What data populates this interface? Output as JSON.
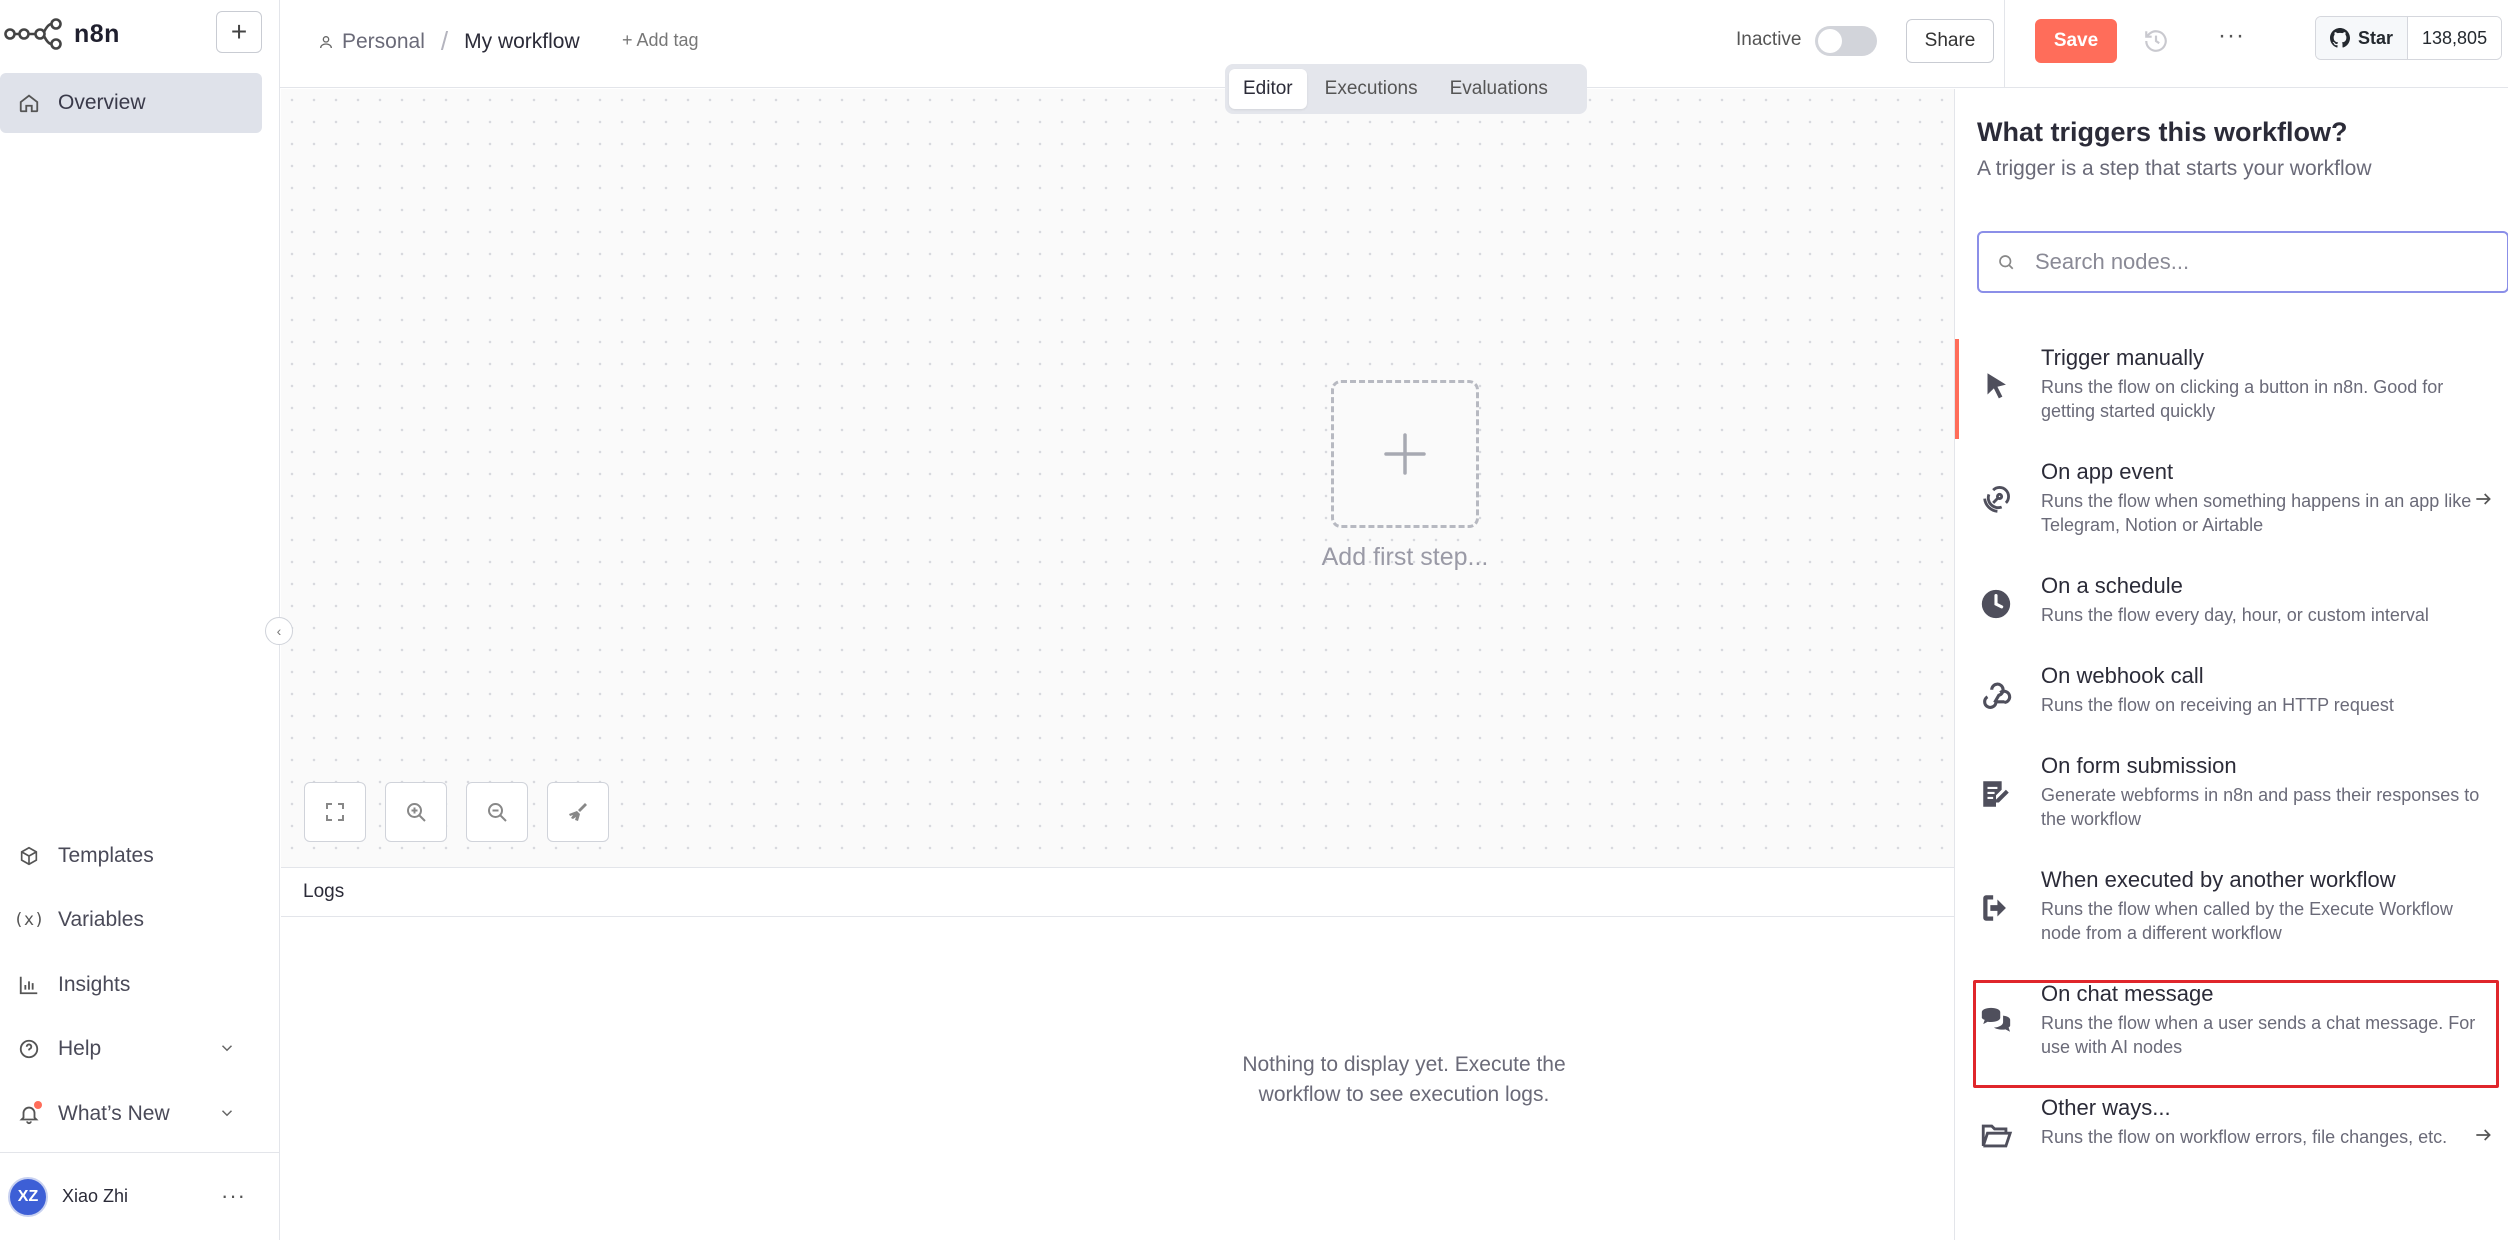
{
  "app": {
    "logo_text": "n8n"
  },
  "sidebar": {
    "overview": "Overview",
    "bottom_items": [
      {
        "label": "Templates",
        "icon": "box-icon"
      },
      {
        "label": "Variables",
        "icon": "variable-icon"
      },
      {
        "label": "Insights",
        "icon": "chart-icon"
      },
      {
        "label": "Help",
        "icon": "help-icon"
      },
      {
        "label": "What’s New",
        "icon": "bell-icon"
      }
    ],
    "user": {
      "initials": "XZ",
      "name": "Xiao Zhi"
    }
  },
  "header": {
    "project": "Personal",
    "workflow_name": "My workflow",
    "add_tag": "+ Add tag",
    "status_label": "Inactive",
    "share_label": "Share",
    "save_label": "Save",
    "github_star": "Star",
    "github_count": "138,805"
  },
  "canvas": {
    "tabs": [
      "Editor",
      "Executions",
      "Evaluations"
    ],
    "active_tab": "Editor",
    "add_first_step": "Add first step..."
  },
  "logs": {
    "title": "Logs",
    "empty_line1": "Nothing to display yet. Execute the",
    "empty_line2": "workflow to see execution logs."
  },
  "panel": {
    "title": "What triggers this workflow?",
    "subtitle": "A trigger is a step that starts your workflow",
    "search_placeholder": "Search nodes...",
    "items": [
      {
        "title": "Trigger manually",
        "desc": "Runs the flow on clicking a button in n8n. Good for getting started quickly",
        "icon": "cursor-icon"
      },
      {
        "title": "On app event",
        "desc": "Runs the flow when something happens in an app like Telegram, Notion or Airtable",
        "icon": "satellite-icon"
      },
      {
        "title": "On a schedule",
        "desc": "Runs the flow every day, hour, or custom interval",
        "icon": "clock-icon"
      },
      {
        "title": "On webhook call",
        "desc": "Runs the flow on receiving an HTTP request",
        "icon": "webhook-icon"
      },
      {
        "title": "On form submission",
        "desc": "Generate webforms in n8n and pass their responses to the workflow",
        "icon": "form-icon"
      },
      {
        "title": "When executed by another workflow",
        "desc": "Runs the flow when called by the Execute Workflow node from a different workflow",
        "icon": "sign-in-icon"
      },
      {
        "title": "On chat message",
        "desc": "Runs the flow when a user sends a chat message. For use with AI nodes",
        "icon": "chat-icon"
      },
      {
        "title": "Other ways...",
        "desc": "Runs the flow on workflow errors, file changes, etc.",
        "icon": "folder-open-icon"
      }
    ]
  },
  "colors": {
    "accent": "#ff6d5a",
    "highlight": "#e0262b",
    "search_border": "#8b8fe8"
  }
}
